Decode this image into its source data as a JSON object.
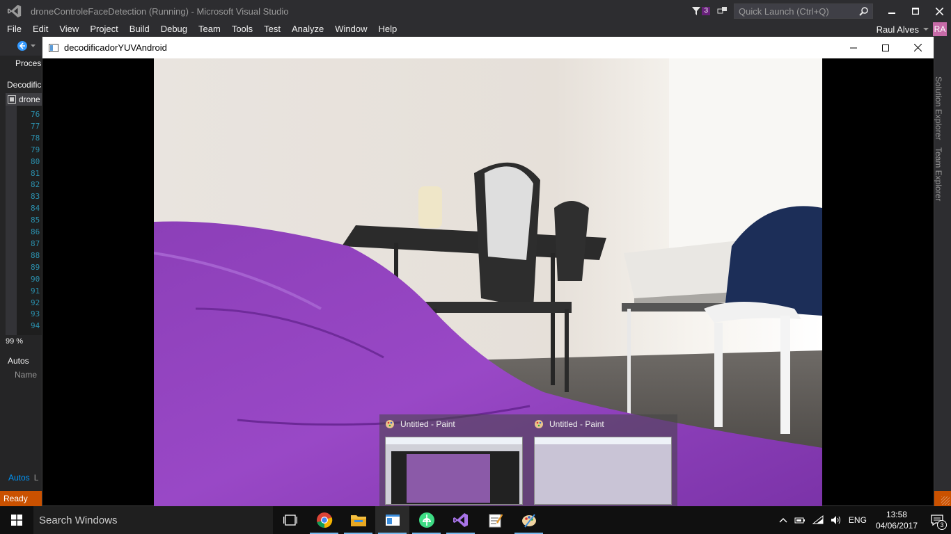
{
  "vs": {
    "title": "droneControleFaceDetection (Running) - Microsoft Visual Studio",
    "notification_count": "3",
    "quick_launch_placeholder": "Quick Launch (Ctrl+Q)",
    "menu": [
      "File",
      "Edit",
      "View",
      "Project",
      "Build",
      "Debug",
      "Team",
      "Tools",
      "Test",
      "Analyze",
      "Window",
      "Help"
    ],
    "user_name": "Raul Alves",
    "user_initials": "RA",
    "process_label": "Proces",
    "document_label": "Decodific",
    "editor_tab": "drone",
    "line_numbers": [
      "76",
      "77",
      "78",
      "79",
      "80",
      "81",
      "82",
      "83",
      "84",
      "85",
      "86",
      "87",
      "88",
      "89",
      "90",
      "91",
      "92",
      "93",
      "94"
    ],
    "zoom": "99 %",
    "autos_title": "Autos",
    "autos_column": "Name",
    "bottom_tabs": [
      "Autos",
      "L"
    ],
    "right_tabs": [
      "Solution Explorer",
      "Team Explorer"
    ],
    "status": "Ready",
    "accent_color": "#ca5100"
  },
  "app_window": {
    "title": "decodificadorYUVAndroid"
  },
  "taskbar": {
    "search_placeholder": "Search Windows",
    "pinned": [
      "task-view",
      "chrome",
      "file-explorer",
      "decodificador-app",
      "android-studio",
      "visual-studio",
      "notepad",
      "paint"
    ],
    "language": "ENG",
    "time": "13:58",
    "date": "04/06/2017",
    "notifications": "3"
  },
  "thumbnails": [
    {
      "title": "Untitled - Paint"
    },
    {
      "title": "Untitled - Paint"
    }
  ]
}
